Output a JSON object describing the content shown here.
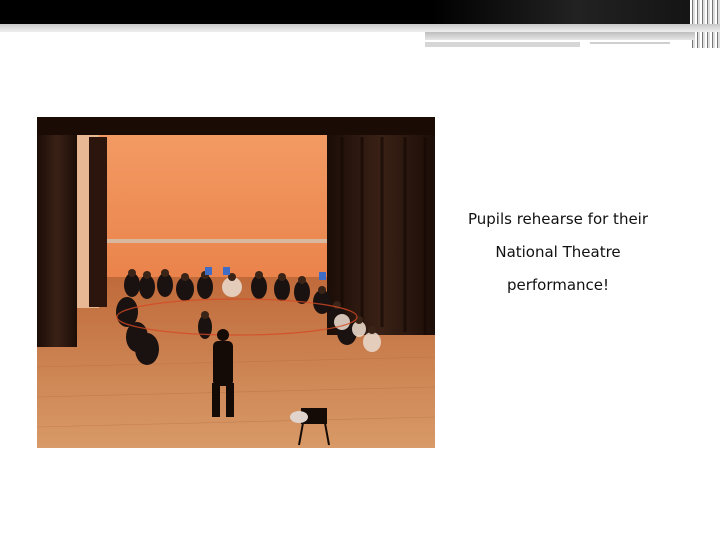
{
  "slide": {
    "caption": {
      "line1": "Pupils rehearse for their",
      "line2": "National Theatre",
      "line3": "performance!"
    }
  },
  "colors": {
    "background": "#ffffff",
    "top_bar": "#000000",
    "stage_wall": "#f0905a",
    "stage_floor": "#c77b4a",
    "curtain": "#2a1710"
  },
  "image": {
    "subject": "photo of pupils seated in a circle on a stage rehearsing, with a teacher standing in the foreground"
  }
}
